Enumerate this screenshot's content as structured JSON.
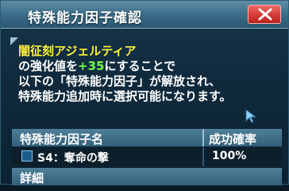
{
  "window": {
    "title": "特殊能力因子確認",
    "close_icon": "close-icon"
  },
  "message": {
    "item_name": "闇征刻アジェルティア",
    "line2_prefix": "の強化値を",
    "line2_value": "+35",
    "line2_suffix": "にすることで",
    "line3": "以下の「特殊能力因子」が解放され、",
    "line4": "特殊能力追加時に選択可能になります。"
  },
  "table": {
    "header_name": "特殊能力因子名",
    "header_rate": "成功確率",
    "rows": [
      {
        "name": "S4：奪命の撃",
        "rate": "100%"
      }
    ]
  },
  "detail": {
    "title": "詳細"
  },
  "colors": {
    "highlight_yellow": "#fff23a",
    "value_green": "#6dff4a",
    "close_red": "#d43b36"
  }
}
